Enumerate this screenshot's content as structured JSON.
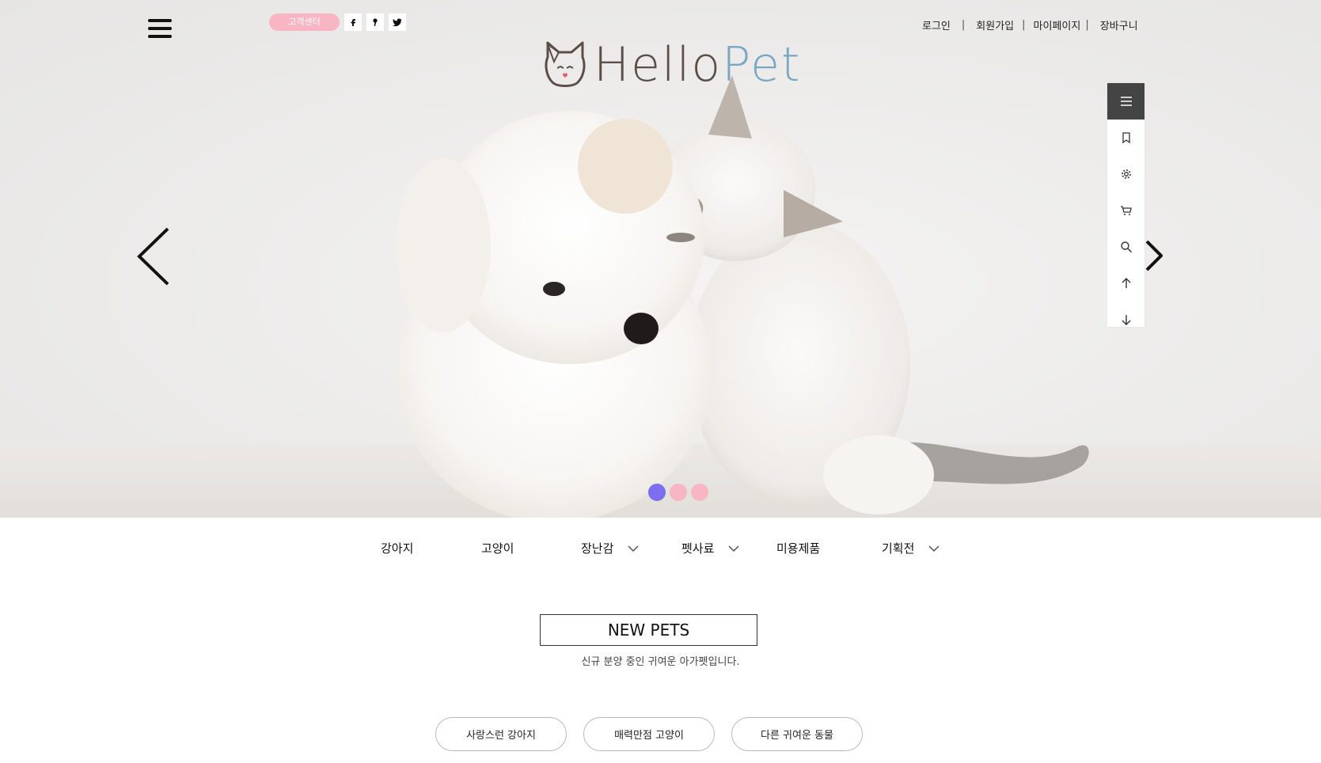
{
  "header": {
    "customer_center_label": "고객센터",
    "social": [
      {
        "name": "facebook",
        "glyph": "f"
      },
      {
        "name": "kakaostory",
        "glyph": "❜"
      },
      {
        "name": "twitter",
        "glyph": "t"
      }
    ],
    "top_links": [
      "로그인",
      "회원가입",
      "마이페이지",
      "장바구니"
    ],
    "separator": "|",
    "logo": {
      "part1": "Hello",
      "part2": "Pet"
    }
  },
  "quickbar": {
    "icons": [
      "menu-icon",
      "bookmark-icon",
      "settings-icon",
      "cart-icon",
      "search-icon",
      "arrow-up-icon",
      "arrow-down-icon"
    ]
  },
  "slider": {
    "dots": [
      {
        "active": true,
        "color": "#7d6ef0"
      },
      {
        "active": false,
        "color": "#f8b5c3"
      },
      {
        "active": false,
        "color": "#f8b5c3"
      }
    ]
  },
  "categories": [
    {
      "label": "강아지",
      "has_dropdown": false
    },
    {
      "label": "고양이",
      "has_dropdown": false
    },
    {
      "label": "장난감",
      "has_dropdown": true
    },
    {
      "label": "펫사료",
      "has_dropdown": true
    },
    {
      "label": "미용제품",
      "has_dropdown": false
    },
    {
      "label": "기획전",
      "has_dropdown": true
    }
  ],
  "section": {
    "title": "NEW PETS",
    "subtitle": "신규 분양 중인 귀여운 아가펫입니다.",
    "buttons": [
      "사랑스런 강아지",
      "매력만점 고양이",
      "다른 귀여운 동물"
    ]
  },
  "colors": {
    "pink": "#f8b5c3",
    "active_dot": "#7d6ef0",
    "logo_dark": "#5a4e46",
    "logo_blue": "#7aa6c4",
    "quickbar_top": "#444444"
  }
}
